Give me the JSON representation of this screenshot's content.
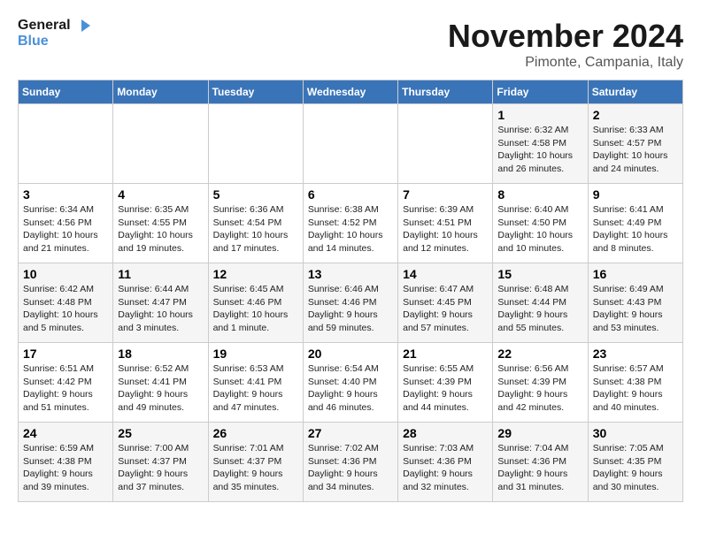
{
  "logo": {
    "line1": "General",
    "line2": "Blue"
  },
  "title": "November 2024",
  "location": "Pimonte, Campania, Italy",
  "weekdays": [
    "Sunday",
    "Monday",
    "Tuesday",
    "Wednesday",
    "Thursday",
    "Friday",
    "Saturday"
  ],
  "weeks": [
    [
      {
        "day": "",
        "info": ""
      },
      {
        "day": "",
        "info": ""
      },
      {
        "day": "",
        "info": ""
      },
      {
        "day": "",
        "info": ""
      },
      {
        "day": "",
        "info": ""
      },
      {
        "day": "1",
        "info": "Sunrise: 6:32 AM\nSunset: 4:58 PM\nDaylight: 10 hours\nand 26 minutes."
      },
      {
        "day": "2",
        "info": "Sunrise: 6:33 AM\nSunset: 4:57 PM\nDaylight: 10 hours\nand 24 minutes."
      }
    ],
    [
      {
        "day": "3",
        "info": "Sunrise: 6:34 AM\nSunset: 4:56 PM\nDaylight: 10 hours\nand 21 minutes."
      },
      {
        "day": "4",
        "info": "Sunrise: 6:35 AM\nSunset: 4:55 PM\nDaylight: 10 hours\nand 19 minutes."
      },
      {
        "day": "5",
        "info": "Sunrise: 6:36 AM\nSunset: 4:54 PM\nDaylight: 10 hours\nand 17 minutes."
      },
      {
        "day": "6",
        "info": "Sunrise: 6:38 AM\nSunset: 4:52 PM\nDaylight: 10 hours\nand 14 minutes."
      },
      {
        "day": "7",
        "info": "Sunrise: 6:39 AM\nSunset: 4:51 PM\nDaylight: 10 hours\nand 12 minutes."
      },
      {
        "day": "8",
        "info": "Sunrise: 6:40 AM\nSunset: 4:50 PM\nDaylight: 10 hours\nand 10 minutes."
      },
      {
        "day": "9",
        "info": "Sunrise: 6:41 AM\nSunset: 4:49 PM\nDaylight: 10 hours\nand 8 minutes."
      }
    ],
    [
      {
        "day": "10",
        "info": "Sunrise: 6:42 AM\nSunset: 4:48 PM\nDaylight: 10 hours\nand 5 minutes."
      },
      {
        "day": "11",
        "info": "Sunrise: 6:44 AM\nSunset: 4:47 PM\nDaylight: 10 hours\nand 3 minutes."
      },
      {
        "day": "12",
        "info": "Sunrise: 6:45 AM\nSunset: 4:46 PM\nDaylight: 10 hours\nand 1 minute."
      },
      {
        "day": "13",
        "info": "Sunrise: 6:46 AM\nSunset: 4:46 PM\nDaylight: 9 hours\nand 59 minutes."
      },
      {
        "day": "14",
        "info": "Sunrise: 6:47 AM\nSunset: 4:45 PM\nDaylight: 9 hours\nand 57 minutes."
      },
      {
        "day": "15",
        "info": "Sunrise: 6:48 AM\nSunset: 4:44 PM\nDaylight: 9 hours\nand 55 minutes."
      },
      {
        "day": "16",
        "info": "Sunrise: 6:49 AM\nSunset: 4:43 PM\nDaylight: 9 hours\nand 53 minutes."
      }
    ],
    [
      {
        "day": "17",
        "info": "Sunrise: 6:51 AM\nSunset: 4:42 PM\nDaylight: 9 hours\nand 51 minutes."
      },
      {
        "day": "18",
        "info": "Sunrise: 6:52 AM\nSunset: 4:41 PM\nDaylight: 9 hours\nand 49 minutes."
      },
      {
        "day": "19",
        "info": "Sunrise: 6:53 AM\nSunset: 4:41 PM\nDaylight: 9 hours\nand 47 minutes."
      },
      {
        "day": "20",
        "info": "Sunrise: 6:54 AM\nSunset: 4:40 PM\nDaylight: 9 hours\nand 46 minutes."
      },
      {
        "day": "21",
        "info": "Sunrise: 6:55 AM\nSunset: 4:39 PM\nDaylight: 9 hours\nand 44 minutes."
      },
      {
        "day": "22",
        "info": "Sunrise: 6:56 AM\nSunset: 4:39 PM\nDaylight: 9 hours\nand 42 minutes."
      },
      {
        "day": "23",
        "info": "Sunrise: 6:57 AM\nSunset: 4:38 PM\nDaylight: 9 hours\nand 40 minutes."
      }
    ],
    [
      {
        "day": "24",
        "info": "Sunrise: 6:59 AM\nSunset: 4:38 PM\nDaylight: 9 hours\nand 39 minutes."
      },
      {
        "day": "25",
        "info": "Sunrise: 7:00 AM\nSunset: 4:37 PM\nDaylight: 9 hours\nand 37 minutes."
      },
      {
        "day": "26",
        "info": "Sunrise: 7:01 AM\nSunset: 4:37 PM\nDaylight: 9 hours\nand 35 minutes."
      },
      {
        "day": "27",
        "info": "Sunrise: 7:02 AM\nSunset: 4:36 PM\nDaylight: 9 hours\nand 34 minutes."
      },
      {
        "day": "28",
        "info": "Sunrise: 7:03 AM\nSunset: 4:36 PM\nDaylight: 9 hours\nand 32 minutes."
      },
      {
        "day": "29",
        "info": "Sunrise: 7:04 AM\nSunset: 4:36 PM\nDaylight: 9 hours\nand 31 minutes."
      },
      {
        "day": "30",
        "info": "Sunrise: 7:05 AM\nSunset: 4:35 PM\nDaylight: 9 hours\nand 30 minutes."
      }
    ]
  ]
}
